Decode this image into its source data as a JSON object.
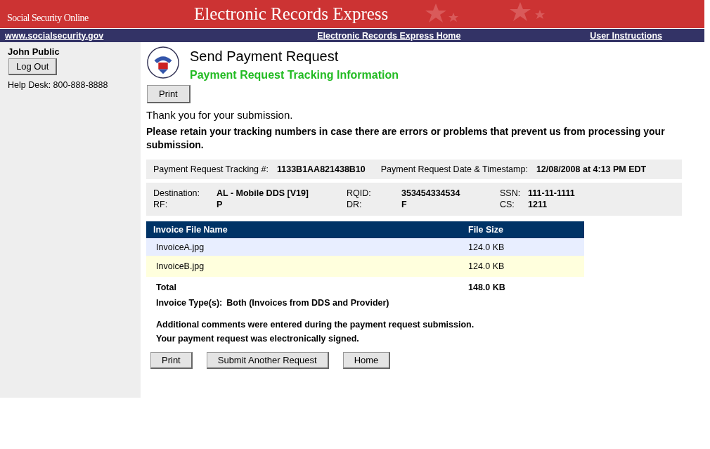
{
  "banner": {
    "brand": "Social Security Online",
    "title": "Electronic Records Express"
  },
  "nav": [
    "www.socialsecurity.gov",
    "Electronic Records Express Home",
    "User Instructions"
  ],
  "sidebar": {
    "user": "John Public",
    "logout": "Log Out",
    "helpdesk": "Help Desk: 800-888-8888"
  },
  "page": {
    "title": "Send Payment Request",
    "subtitle": "Payment Request Tracking Information",
    "print": "Print",
    "thanks": "Thank you for your submission.",
    "retain": "Please retain your tracking numbers in case there are errors or problems that prevent us from processing your submission."
  },
  "tracking": [
    {
      "label": "Payment Request Tracking #:",
      "value": "1133B1AA821438B10"
    },
    {
      "label": "Payment Request Date & Timestamp:",
      "value": "12/08/2008 at 4:13 PM EDT"
    }
  ],
  "details": [
    [
      {
        "label": "Destination:",
        "value": "AL - Mobile DDS [V19]"
      },
      {
        "label": "RQID:",
        "value": "353454334534"
      },
      {
        "label": "SSN:",
        "value": "111-11-1111"
      }
    ],
    [
      {
        "label": "RF:",
        "value": "P"
      },
      {
        "label": "DR:",
        "value": "F"
      },
      {
        "label": "CS:",
        "value": "1211"
      }
    ]
  ],
  "table": {
    "columns": [
      "Invoice File Name",
      "File Size"
    ],
    "rows": [
      [
        "InvoiceA.jpg",
        "124.0 KB"
      ],
      [
        "InvoiceB.jpg",
        "124.0 KB"
      ]
    ],
    "total": [
      "Total",
      "148.0 KB"
    ]
  },
  "invoice_type": {
    "label": "Invoice Type(s):",
    "value": "Both (Invoices from DDS and Provider)"
  },
  "notes": [
    "Additional comments were entered during the payment request submission.",
    "Your payment request was electronically signed."
  ],
  "buttons": [
    "Print",
    "Submit Another Request",
    "Home"
  ]
}
